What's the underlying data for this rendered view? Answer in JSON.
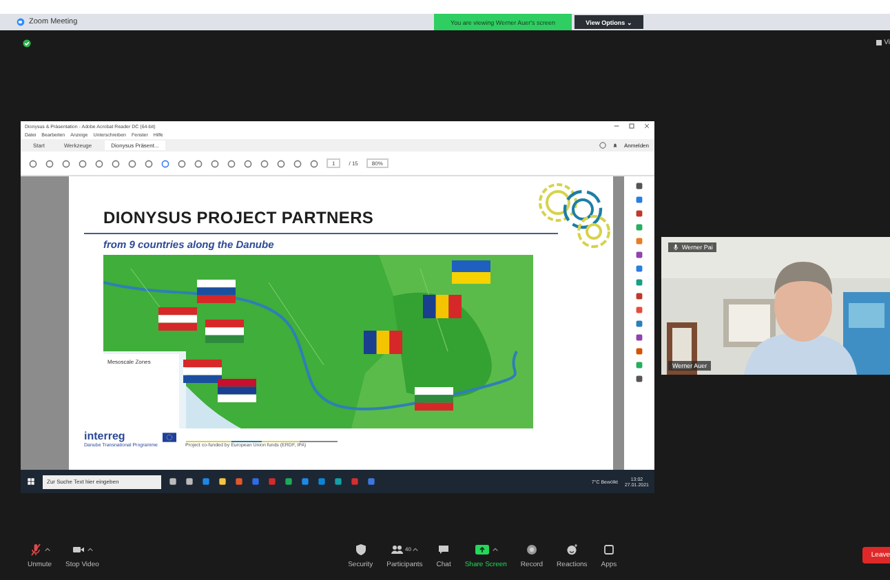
{
  "window": {
    "title": "Zoom Meeting"
  },
  "banner": {
    "text": "You are viewing Werner Auer's screen",
    "button": "View Options ⌄"
  },
  "corner_label": "Vi",
  "acrobat": {
    "title": "Dionysus & Präsentation - Adobe Acrobat Reader DC (64-bit)",
    "menu": [
      "Datei",
      "Bearbeiten",
      "Anzeige",
      "Unterschreiben",
      "Fenster",
      "Hilfe"
    ],
    "tabs": [
      {
        "label": "Start",
        "selected": false
      },
      {
        "label": "Werkzeuge",
        "selected": false
      },
      {
        "label": "Dionysus Präsent...",
        "selected": true
      }
    ],
    "sign_in": "Anmelden",
    "page": "1",
    "pages": "/ 15",
    "zoom": "80%",
    "slide": {
      "title": "DIONYSUS PROJECT PARTNERS",
      "subtitle": "from 9 countries along the Danube",
      "legend_title": "Mesoscale Zones",
      "logo": "interreg",
      "programme": "Danube Transnational Programme",
      "footer": "Project co-funded by European Union funds (ERDF, IPA)"
    }
  },
  "taskbar": {
    "search_placeholder": "Zur Suche Text hier eingeben",
    "weather": "7°C Bewölkt",
    "time": "13:02",
    "date": "27.01.2021"
  },
  "video": {
    "name": "Werner Pai",
    "nameplate": "Werner Auer"
  },
  "toolbar": [
    {
      "kind": "mic",
      "label": "Unmute",
      "muted": true,
      "caret": true
    },
    {
      "kind": "video",
      "label": "Stop Video",
      "caret": true
    },
    {
      "kind": "security",
      "label": "Security"
    },
    {
      "kind": "participants",
      "label": "Participants",
      "count": "40",
      "caret": true
    },
    {
      "kind": "chat",
      "label": "Chat"
    },
    {
      "kind": "share",
      "label": "Share Screen",
      "caret": true
    },
    {
      "kind": "record",
      "label": "Record"
    },
    {
      "kind": "reactions",
      "label": "Reactions"
    },
    {
      "kind": "apps",
      "label": "Apps"
    }
  ],
  "leave": "Leave"
}
